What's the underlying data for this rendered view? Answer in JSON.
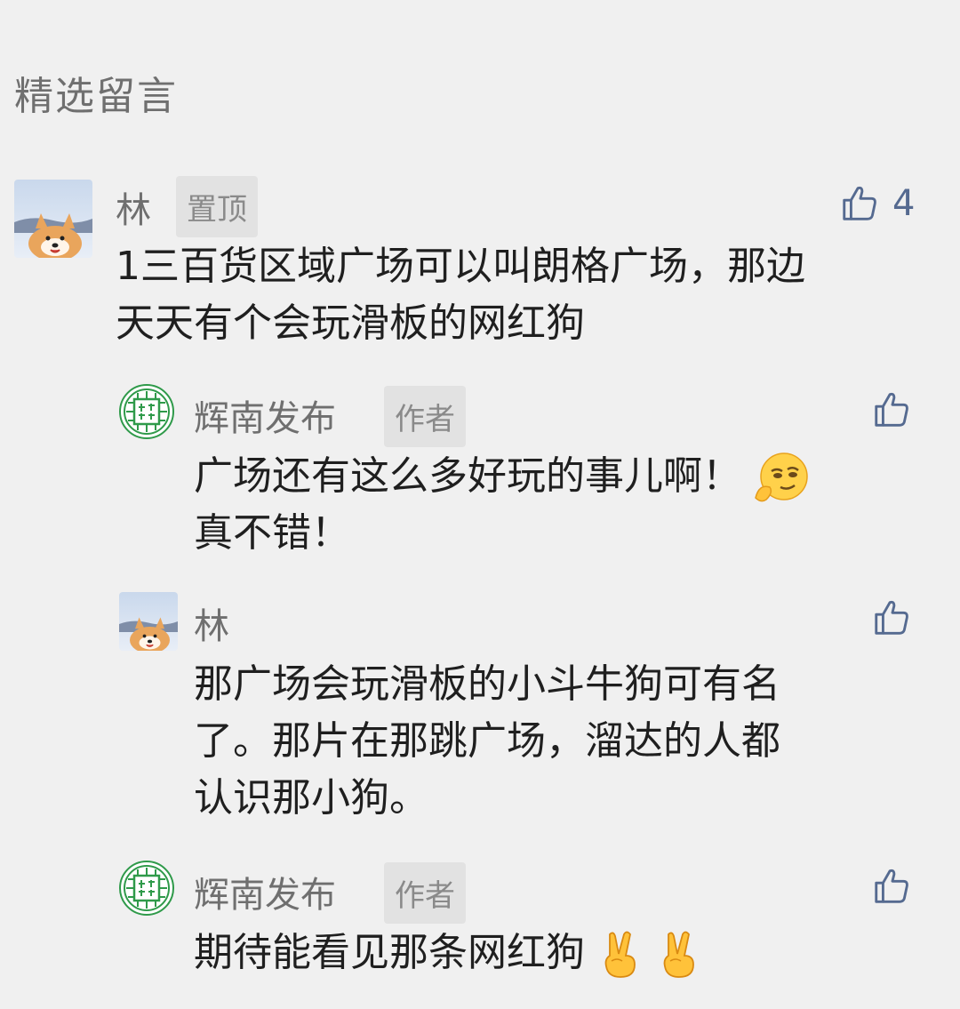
{
  "section": {
    "title": "精选留言"
  },
  "comments": [
    {
      "name": "林",
      "tag": "置顶",
      "text_lines": [
        "1三百货区域广场可以叫朗格广场，那边",
        "天天有个会玩滑板的网红狗"
      ],
      "likes": "4"
    }
  ],
  "replies": [
    {
      "name": "辉南发布",
      "tag": "作者",
      "text_lines": [
        "广场还有这么多好玩的事儿啊！",
        "真不错！"
      ],
      "emoji": "smirk-emoji"
    },
    {
      "name": "林",
      "text_lines": [
        "那广场会玩滑板的小斗牛狗可有名",
        "了。那片在那跳广场，溜达的人都",
        "认识那小狗。"
      ]
    },
    {
      "name": "辉南发布",
      "tag": "作者",
      "text_lines": [
        "期待能看见那条网红狗"
      ],
      "emoji": "victory-hand-emoji"
    }
  ],
  "colors": {
    "background": "#f0f0f0",
    "like_icon": "#556a90",
    "author_brand": "#2f9a4a"
  },
  "icons": [
    "thumbs-up-icon",
    "shiba-avatar",
    "huinan-logo"
  ]
}
